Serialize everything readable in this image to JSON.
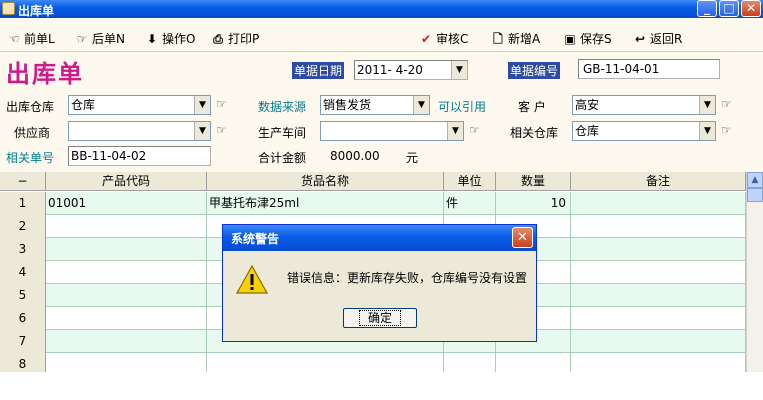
{
  "window": {
    "title": "出库单"
  },
  "toolbar": {
    "prev": "前单L",
    "next": "后单N",
    "operate": "操作O",
    "print": "打印P",
    "audit": "审核C",
    "new": "新增A",
    "save": "保存S",
    "back": "返回R"
  },
  "form": {
    "doc_title": "出库单",
    "date_label": "单据日期",
    "date_value": "2011- 4-20",
    "docno_label": "单据编号",
    "docno_value": "GB-11-04-01",
    "warehouse_label": "出库仓库",
    "warehouse_value": "仓库",
    "source_label": "数据来源",
    "source_value": "销售发货",
    "cite_label": "可以引用",
    "customer_label": "客 户",
    "customer_value": "高安",
    "supplier_label": "供应商",
    "supplier_value": "",
    "workshop_label": "生产车间",
    "workshop_value": "",
    "rel_wh_label": "相关仓库",
    "rel_wh_value": "仓库",
    "rel_no_label": "相关单号",
    "rel_no_value": "BB-11-04-02",
    "total_label": "合计金额",
    "total_value": "8000.00",
    "total_unit": "元"
  },
  "grid": {
    "headers": [
      "−",
      "产品代码",
      "货品名称",
      "单位",
      "数量",
      "备注"
    ],
    "rows": [
      {
        "num": "1",
        "code": "01001",
        "name": "甲基托布津25ml",
        "unit": "件",
        "qty": "10",
        "note": ""
      },
      {
        "num": "2",
        "code": "",
        "name": "",
        "unit": "",
        "qty": "",
        "note": ""
      },
      {
        "num": "3",
        "code": "",
        "name": "",
        "unit": "",
        "qty": "",
        "note": ""
      },
      {
        "num": "4",
        "code": "",
        "name": "",
        "unit": "",
        "qty": "",
        "note": ""
      },
      {
        "num": "5",
        "code": "",
        "name": "",
        "unit": "",
        "qty": "",
        "note": ""
      },
      {
        "num": "6",
        "code": "",
        "name": "",
        "unit": "",
        "qty": "",
        "note": ""
      },
      {
        "num": "7",
        "code": "",
        "name": "",
        "unit": "",
        "qty": "",
        "note": ""
      },
      {
        "num": "8",
        "code": "",
        "name": "",
        "unit": "",
        "qty": "",
        "note": ""
      }
    ]
  },
  "dialog": {
    "title": "系统警告",
    "message": "错误信息：更新库存失败，仓库编号没有设置",
    "ok_label": "确定"
  },
  "icons": {
    "prev": "hand-left-icon",
    "next": "hand-right-icon",
    "operate": "arrow-down-icon",
    "print": "print-icon",
    "audit": "checkmark-icon",
    "new": "new-doc-icon",
    "save": "floppy-icon",
    "back": "return-icon",
    "warning": "warning-icon"
  },
  "colors": {
    "accent": "#0a5ce6",
    "title_magenta": "#d01a8a",
    "teal_label": "#00808b",
    "grid_alt": "#e8f9f0"
  }
}
